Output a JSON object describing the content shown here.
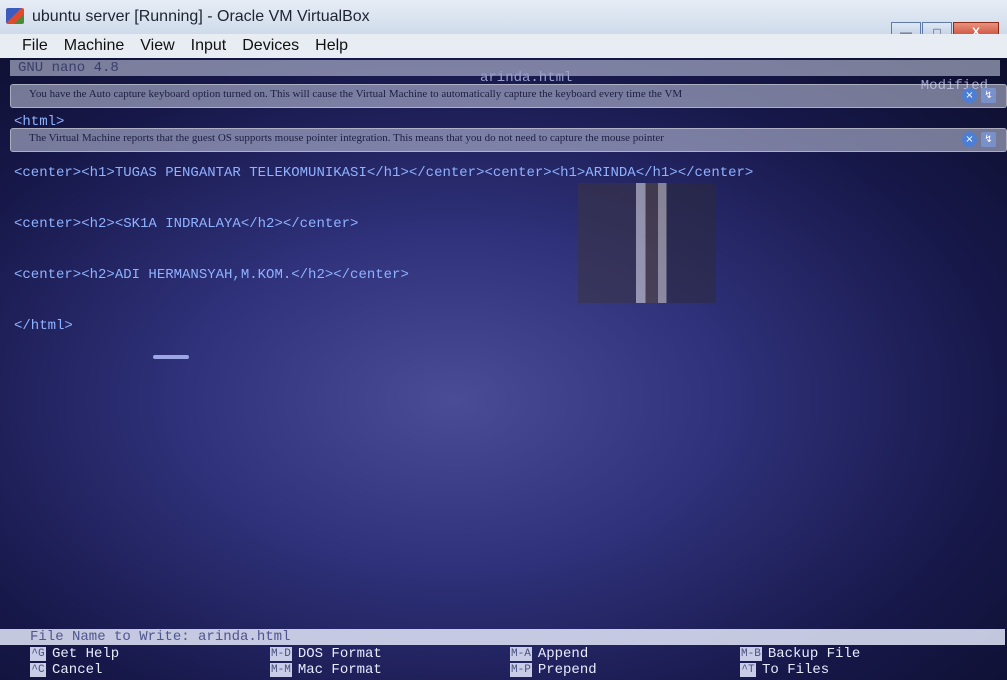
{
  "window": {
    "title": "ubuntu server [Running] - Oracle VM VirtualBox",
    "buttons": {
      "minimize": "—",
      "maximize": "□",
      "close": "X"
    }
  },
  "menu": [
    "File",
    "Machine",
    "View",
    "Input",
    "Devices",
    "Help"
  ],
  "nano": {
    "version": "GNU nano 4.8",
    "filename": "arinda.html",
    "status": "Modified",
    "lines": [
      "<html>",
      "<center><h1>TUGAS PENGANTAR TELEKOMUNIKASI</h1></center><center><h1>ARINDA</h1></center>",
      "<center><h2><SK1A INDRALAYA</h2></center>",
      "<center><h2>ADI HERMANSYAH,M.KOM.</h2></center>",
      "</html>"
    ],
    "prompt": "File Name to Write: arinda.html",
    "shortcuts": [
      [
        {
          "key": "^G",
          "label": "Get Help"
        },
        {
          "key": "M-D",
          "label": "DOS Format"
        },
        {
          "key": "M-A",
          "label": "Append"
        },
        {
          "key": "M-B",
          "label": "Backup File"
        }
      ],
      [
        {
          "key": "^C",
          "label": "Cancel"
        },
        {
          "key": "M-M",
          "label": "Mac Format"
        },
        {
          "key": "M-P",
          "label": "Prepend"
        },
        {
          "key": "^T",
          "label": "To Files"
        }
      ]
    ]
  },
  "notifications": {
    "keyboard": "You have the Auto capture keyboard option turned on. This will cause the Virtual Machine to automatically capture the keyboard every time the VM",
    "mouse": "The Virtual Machine reports that the guest OS supports mouse pointer integration. This means that you do not need to capture the mouse pointer"
  }
}
